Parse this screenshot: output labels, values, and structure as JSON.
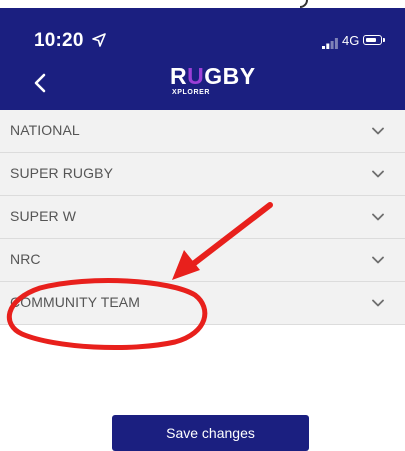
{
  "status_bar": {
    "time": "10:20",
    "network": "4G",
    "location_icon": "location-arrow-icon",
    "signal_icon": "signal-bars-icon",
    "battery_icon": "battery-icon"
  },
  "header": {
    "back_icon": "chevron-left-icon",
    "logo": {
      "accent_letter": "U",
      "word_start": "R",
      "word_end": "GBY",
      "subtitle": "XPLORER"
    }
  },
  "filters": {
    "items": [
      {
        "label": "NATIONAL",
        "icon": "chevron-down-icon"
      },
      {
        "label": "SUPER RUGBY",
        "icon": "chevron-down-icon"
      },
      {
        "label": "SUPER W",
        "icon": "chevron-down-icon"
      },
      {
        "label": "NRC",
        "icon": "chevron-down-icon"
      },
      {
        "label": "COMMUNITY TEAM",
        "icon": "chevron-down-icon"
      }
    ]
  },
  "footer": {
    "save_label": "Save changes"
  },
  "colors": {
    "brand_navy": "#1b1f80",
    "logo_accent": "#9b3fd6",
    "row_background": "#f2f2f2",
    "annotation_red": "#e8201c"
  }
}
